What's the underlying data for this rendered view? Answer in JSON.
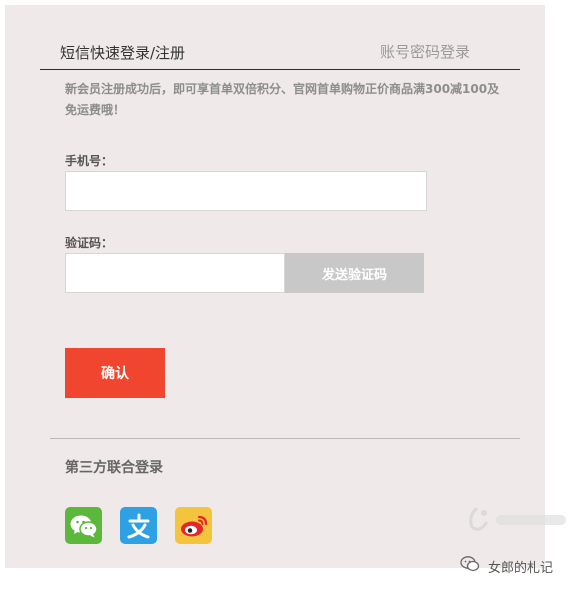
{
  "tabs": {
    "sms_login": "短信快速登录/注册",
    "password_login": "账号密码登录"
  },
  "promo_text": "新会员注册成功后，即可享首单双倍积分、官网首单购物正价商品满300减100及免运费哦！",
  "phone": {
    "label": "手机号：",
    "value": "",
    "placeholder": ""
  },
  "code": {
    "label": "验证码：",
    "value": "",
    "placeholder": "",
    "send_label": "发送验证码"
  },
  "confirm_label": "确认",
  "third_party": {
    "title": "第三方联合登录",
    "providers": [
      "wechat-icon",
      "alipay-icon",
      "weibo-icon"
    ]
  },
  "footer": {
    "account_name": "女郎的札记"
  },
  "colors": {
    "panel_bg": "#efe9e9",
    "confirm_red": "#f0452f",
    "send_gray": "#c8c8c8",
    "wechat_green": "#5bb83b",
    "alipay_blue": "#2ea0e4",
    "weibo_yellow": "#f5c43d"
  }
}
